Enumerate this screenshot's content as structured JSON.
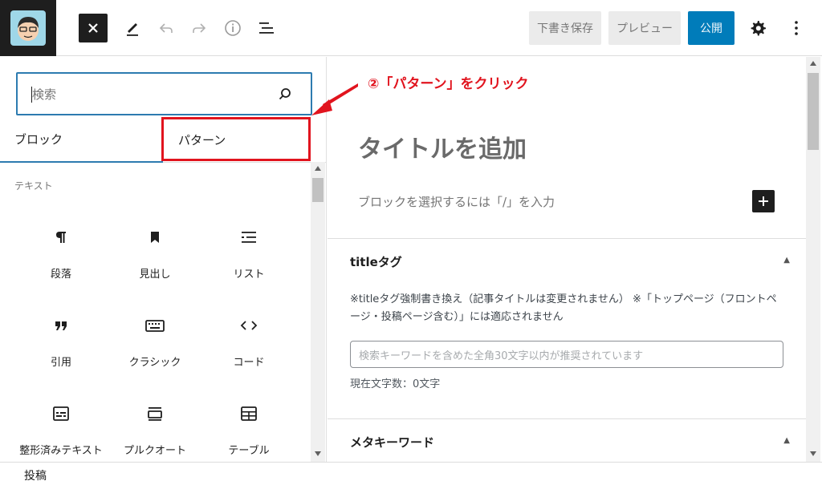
{
  "toolbar": {
    "draft_label": "下書き保存",
    "preview_label": "プレビュー",
    "publish_label": "公開",
    "accent": "#007cba"
  },
  "inserter": {
    "search_placeholder": "検索",
    "tabs": [
      {
        "label": "ブロック",
        "active": true
      },
      {
        "label": "パターン",
        "active": false
      }
    ],
    "category": "テキスト",
    "blocks": [
      {
        "label": "段落",
        "icon": "paragraph-icon"
      },
      {
        "label": "見出し",
        "icon": "heading-icon"
      },
      {
        "label": "リスト",
        "icon": "list-icon"
      },
      {
        "label": "引用",
        "icon": "quote-icon"
      },
      {
        "label": "クラシック",
        "icon": "keyboard-icon"
      },
      {
        "label": "コード",
        "icon": "code-icon"
      },
      {
        "label": "整形済みテキスト",
        "icon": "preformatted-icon"
      },
      {
        "label": "プルクオート",
        "icon": "pullquote-icon"
      },
      {
        "label": "テーブル",
        "icon": "table-icon"
      }
    ]
  },
  "annotation": {
    "text": "②「パターン」をクリック",
    "color": "#e1141e"
  },
  "editor": {
    "title_placeholder": "タイトルを追加",
    "block_prompt": "ブロックを選択するには「/」を入力"
  },
  "meta": {
    "title_tag": {
      "heading": "titleタグ",
      "description": "※titleタグ強制書き換え（記事タイトルは変更されません） ※「トップページ（フロントページ・投稿ページ含む）」には適応されません",
      "input_placeholder": "検索キーワードを含めた全角30文字以内が推奨されています",
      "count_text": "現在文字数：0文字"
    },
    "keyword": {
      "heading": "メタキーワード"
    }
  },
  "statusbar": {
    "label": "投稿"
  }
}
